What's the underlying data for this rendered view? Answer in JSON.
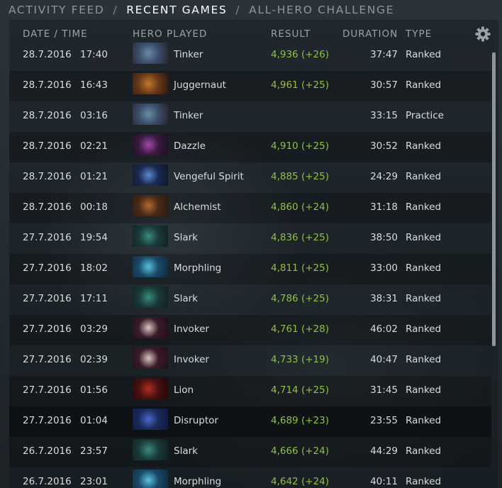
{
  "nav": {
    "tabs": [
      "ACTIVITY FEED",
      "RECENT GAMES",
      "ALL-HERO CHALLENGE"
    ],
    "separator": "/",
    "active_index": 1
  },
  "columns": {
    "date_time": "DATE / TIME",
    "hero": "HERO PLAYED",
    "result": "RESULT",
    "duration": "DURATION",
    "type": "TYPE"
  },
  "settings_icon": "gear-icon",
  "colors": {
    "result_green": "#8fc23f",
    "accent_white": "#ffffff"
  },
  "games": [
    {
      "date": "28.7.2016",
      "time": "17:40",
      "hero": "Tinker",
      "result": "4,936 (+26)",
      "duration": "37:47",
      "type": "Ranked"
    },
    {
      "date": "28.7.2016",
      "time": "16:43",
      "hero": "Juggernaut",
      "result": "4,961 (+25)",
      "duration": "30:57",
      "type": "Ranked"
    },
    {
      "date": "28.7.2016",
      "time": "03:16",
      "hero": "Tinker",
      "result": "",
      "duration": "33:15",
      "type": "Practice"
    },
    {
      "date": "28.7.2016",
      "time": "02:21",
      "hero": "Dazzle",
      "result": "4,910 (+25)",
      "duration": "30:52",
      "type": "Ranked"
    },
    {
      "date": "28.7.2016",
      "time": "01:21",
      "hero": "Vengeful Spirit",
      "result": "4,885 (+25)",
      "duration": "24:29",
      "type": "Ranked"
    },
    {
      "date": "28.7.2016",
      "time": "00:18",
      "hero": "Alchemist",
      "result": "4,860 (+24)",
      "duration": "31:18",
      "type": "Ranked"
    },
    {
      "date": "27.7.2016",
      "time": "19:54",
      "hero": "Slark",
      "result": "4,836 (+25)",
      "duration": "38:50",
      "type": "Ranked"
    },
    {
      "date": "27.7.2016",
      "time": "18:02",
      "hero": "Morphling",
      "result": "4,811 (+25)",
      "duration": "33:00",
      "type": "Ranked"
    },
    {
      "date": "27.7.2016",
      "time": "17:11",
      "hero": "Slark",
      "result": "4,786 (+25)",
      "duration": "38:31",
      "type": "Ranked"
    },
    {
      "date": "27.7.2016",
      "time": "03:29",
      "hero": "Invoker",
      "result": "4,761 (+28)",
      "duration": "46:02",
      "type": "Ranked"
    },
    {
      "date": "27.7.2016",
      "time": "02:39",
      "hero": "Invoker",
      "result": "4,733 (+19)",
      "duration": "40:47",
      "type": "Ranked"
    },
    {
      "date": "27.7.2016",
      "time": "01:56",
      "hero": "Lion",
      "result": "4,714 (+25)",
      "duration": "31:45",
      "type": "Ranked"
    },
    {
      "date": "27.7.2016",
      "time": "01:04",
      "hero": "Disruptor",
      "result": "4,689 (+23)",
      "duration": "23:55",
      "type": "Ranked"
    },
    {
      "date": "26.7.2016",
      "time": "23:57",
      "hero": "Slark",
      "result": "4,666 (+24)",
      "duration": "44:29",
      "type": "Ranked"
    },
    {
      "date": "26.7.2016",
      "time": "23:01",
      "hero": "Morphling",
      "result": "4,642 (+24)",
      "duration": "40:11",
      "type": "Ranked"
    }
  ]
}
